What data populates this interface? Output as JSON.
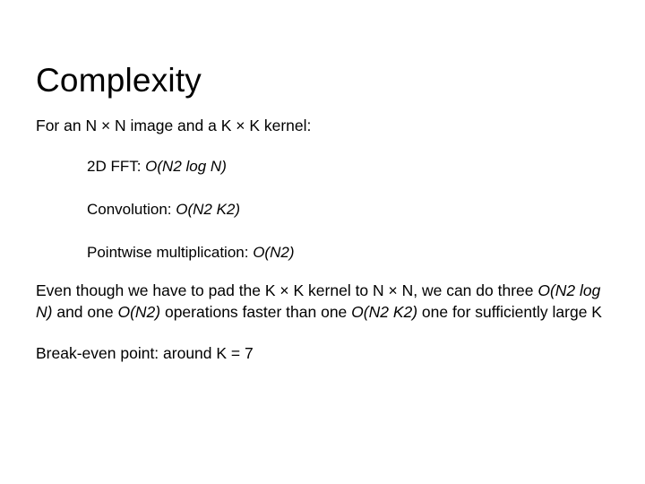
{
  "slide": {
    "title": "Complexity",
    "intro": "For an N × N image and a K × K kernel:",
    "items": [
      {
        "label": "2D FFT: ",
        "complexity": "O(N2 log N)"
      },
      {
        "label": "Convolution: ",
        "complexity": "O(N2 K2)"
      },
      {
        "label": "Pointwise multiplication: ",
        "complexity": "O(N2)"
      }
    ],
    "paragraph": {
      "part1": "Even though we have to pad the K × K kernel to N × N, we can do three ",
      "em1": "O(N2 log N)",
      "part2": " and one ",
      "em2": "O(N2)",
      "part3": " operations faster than one ",
      "em3": "O(N2 K2)",
      "part4": " one for sufficiently large K"
    },
    "breakeven": "Break-even point: around K = 7"
  },
  "colors": {
    "background": "#ffffff",
    "text": "#000000"
  }
}
